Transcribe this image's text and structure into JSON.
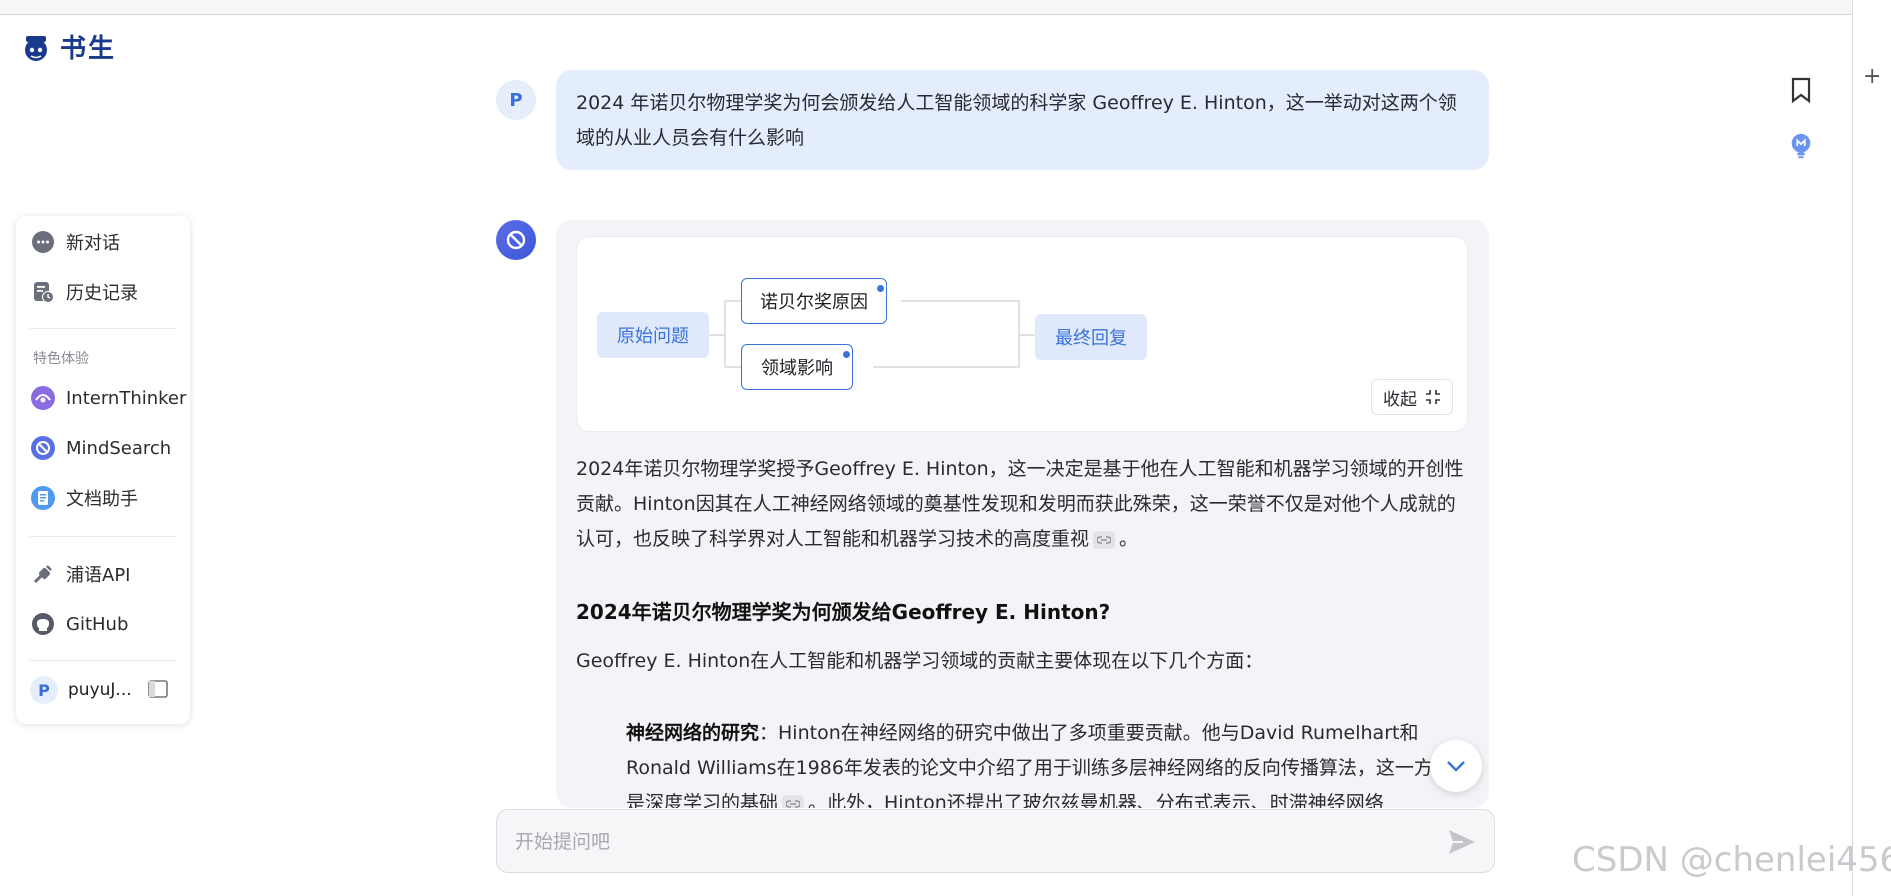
{
  "app": {
    "logo_text": "书生"
  },
  "sidebar": {
    "items": [
      {
        "label": "新对话",
        "icon": "chat-bubble-icon"
      },
      {
        "label": "历史记录",
        "icon": "history-icon"
      }
    ],
    "section_title": "特色体验",
    "features": [
      {
        "label": "InternThinker",
        "icon": "intern-thinker-icon"
      },
      {
        "label": "MindSearch",
        "icon": "mindsearch-icon"
      },
      {
        "label": "文档助手",
        "icon": "document-assistant-icon"
      }
    ],
    "links": [
      {
        "label": "浦语API",
        "icon": "plug-icon"
      },
      {
        "label": "GitHub",
        "icon": "github-icon"
      }
    ],
    "user": {
      "avatar_letter": "P",
      "name": "puyuJ..."
    }
  },
  "conversation": {
    "user_avatar_letter": "P",
    "user_question": "2024 年诺贝尔物理学奖为何会颁发给人工智能领域的科学家 Geoffrey E. Hinton，这一举动对这两个领域的从业人员会有什么影响",
    "mindmap": {
      "root": "原始问题",
      "branches": [
        "诺贝尔奖原因",
        "领域影响"
      ],
      "result": "最终回复",
      "collapse_label": "收起"
    },
    "answer_paragraph": "2024年诺贝尔物理学奖授予Geoffrey E. Hinton，这一决定是基于他在人工智能和机器学习领域的开创性贡献。Hinton因其在人工神经网络领域的奠基性发现和发明而获此殊荣，这一荣誉不仅是对他个人成就的认可，也反映了科学界对人工智能和机器学习技术的高度重视",
    "answer_paragraph_end": "。",
    "heading": "2024年诺贝尔物理学奖为何颁发给Geoffrey E. Hinton?",
    "intro": "Geoffrey E. Hinton在人工智能和机器学习领域的贡献主要体现在以下几个方面：",
    "bullet": {
      "title": "神经网络的研究",
      "text_a": "：Hinton在神经网络的研究中做出了多项重要贡献。他与David Rumelhart和Ronald Williams在1986年发表的论文中介绍了用于训练多层神经网络的反向传播算法，这一方法是深度学习的基础",
      "text_b": "。此外，Hinton还提出了玻尔兹曼机器、分布式表示、时滞神经网络"
    }
  },
  "input": {
    "placeholder": "开始提问吧"
  },
  "watermark": "CSDN @chenlei456",
  "colors": {
    "accent": "#3b73d9",
    "user_bubble": "#e3edfd",
    "answer_bg": "#f3f4f7"
  }
}
